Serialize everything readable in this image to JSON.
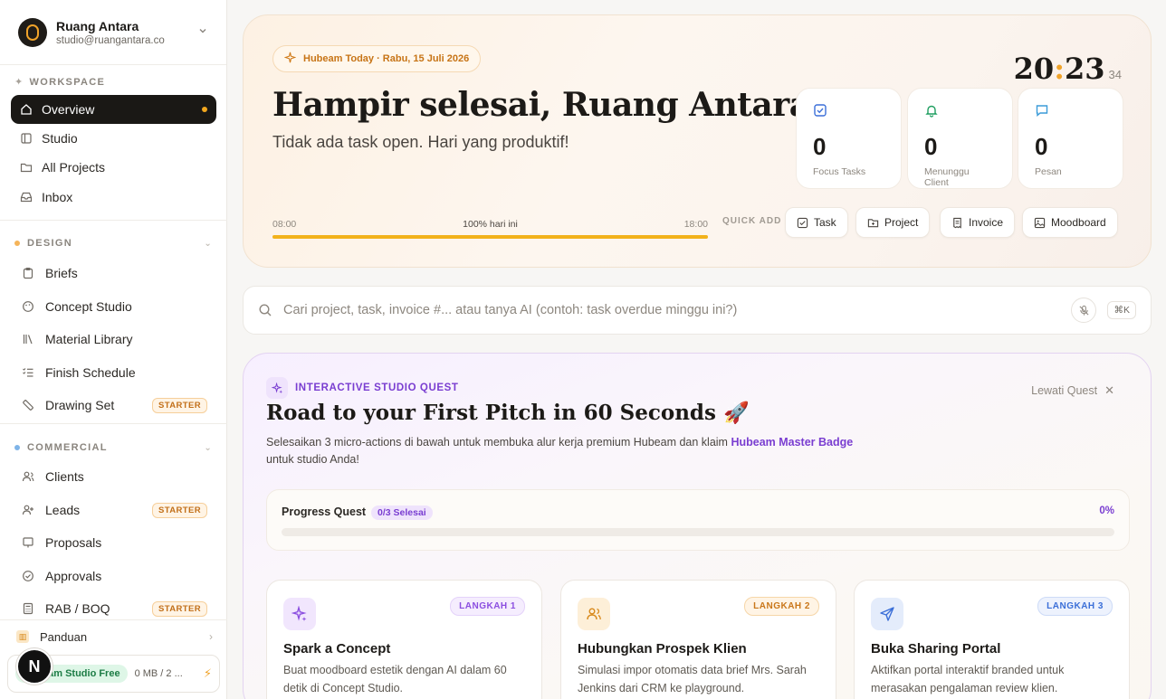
{
  "workspace": {
    "name": "Ruang Antara",
    "email": "studio@ruangantara.co"
  },
  "sidebar": {
    "workspace_label": "WORKSPACE",
    "workspace_items": [
      {
        "label": "Overview",
        "icon": "home-icon",
        "active": true
      },
      {
        "label": "Studio",
        "icon": "layout-icon"
      },
      {
        "label": "All Projects",
        "icon": "folder-icon"
      },
      {
        "label": "Inbox",
        "icon": "inbox-icon"
      }
    ],
    "design_label": "DESIGN",
    "design_color": "#f5b45a",
    "design_items": [
      {
        "label": "Briefs",
        "icon": "clipboard-icon"
      },
      {
        "label": "Concept Studio",
        "icon": "palette-icon"
      },
      {
        "label": "Material Library",
        "icon": "library-icon"
      },
      {
        "label": "Finish Schedule",
        "icon": "list-check-icon"
      },
      {
        "label": "Drawing Set",
        "icon": "ruler-icon",
        "badge": "STARTER"
      }
    ],
    "commercial_label": "COMMERCIAL",
    "commercial_color": "#7fb4e8",
    "commercial_items": [
      {
        "label": "Clients",
        "icon": "users-icon"
      },
      {
        "label": "Leads",
        "icon": "user-plus-icon",
        "badge": "STARTER"
      },
      {
        "label": "Proposals",
        "icon": "presentation-icon"
      },
      {
        "label": "Approvals",
        "icon": "check-circle-icon"
      },
      {
        "label": "RAB / BOQ",
        "icon": "calculator-icon",
        "badge": "STARTER"
      }
    ],
    "panduan": "Panduan",
    "plan": {
      "name": "eam Studio Free",
      "usage": "0 MB / 2 ..."
    },
    "avatar_letter": "N"
  },
  "hero": {
    "today": "Hubeam Today · Rabu, 15 Juli 2026",
    "title": "Hampir selesai, Ruang Antara.",
    "subtitle": "Tidak ada task open. Hari yang produktif!",
    "clock": {
      "hours": "20",
      "minutes": "23",
      "seconds": "34"
    },
    "day_start": "08:00",
    "day_end": "18:00",
    "day_progress_label": "100% hari ini",
    "day_progress": 1.0,
    "stats": [
      {
        "value": "0",
        "label": "Focus Tasks",
        "icon": "check-square-icon",
        "color": "#3b6fd8"
      },
      {
        "value": "0",
        "label": "Menunggu Client",
        "icon": "bell-icon",
        "color": "#1f9e60"
      },
      {
        "value": "0",
        "label": "Pesan",
        "icon": "message-icon",
        "color": "#3b9bd8"
      }
    ],
    "quick_add_label": "QUICK ADD",
    "quick_add": [
      {
        "label": "Task",
        "icon": "check-square-icon"
      },
      {
        "label": "Project",
        "icon": "folder-plus-icon"
      },
      {
        "label": "Invoice",
        "icon": "receipt-icon"
      },
      {
        "label": "Moodboard",
        "icon": "image-icon"
      }
    ]
  },
  "search": {
    "placeholder": "Cari project, task, invoice #... atau tanya AI (contoh: task overdue minggu ini?)",
    "value": "",
    "shortcut": "⌘K"
  },
  "quest": {
    "label": "INTERACTIVE STUDIO QUEST",
    "title": "Road to your First Pitch in 60 Seconds 🚀",
    "desc_before": "Selesaikan 3 micro-actions di bawah untuk membuka alur kerja premium Hubeam dan klaim ",
    "desc_highlight": "Hubeam Master Badge",
    "desc_after": " untuk studio Anda!",
    "skip": "Lewati Quest",
    "progress_label": "Progress Quest",
    "progress_badge": "0/3 Selesai",
    "progress_pct": "0%",
    "progress": 0,
    "steps": [
      {
        "badge": "LANGKAH 1",
        "title": "Spark a Concept",
        "desc": "Buat moodboard estetik dengan AI dalam 60 detik di Concept Studio.",
        "icon": "sparkles-icon",
        "color": "#8b4ee0",
        "bg": "#f1e6fd"
      },
      {
        "badge": "LANGKAH 2",
        "title": "Hubungkan Prospek Klien",
        "desc": "Simulasi impor otomatis data brief Mrs. Sarah Jenkins dari CRM ke playground.",
        "icon": "users-icon",
        "color": "#d8891b",
        "bg": "#fdefd8"
      },
      {
        "badge": "LANGKAH 3",
        "title": "Buka Sharing Portal",
        "desc": "Aktifkan portal interaktif branded untuk merasakan pengalaman review klien.",
        "icon": "send-icon",
        "color": "#3b6fd8",
        "bg": "#e4ecfb"
      }
    ]
  }
}
